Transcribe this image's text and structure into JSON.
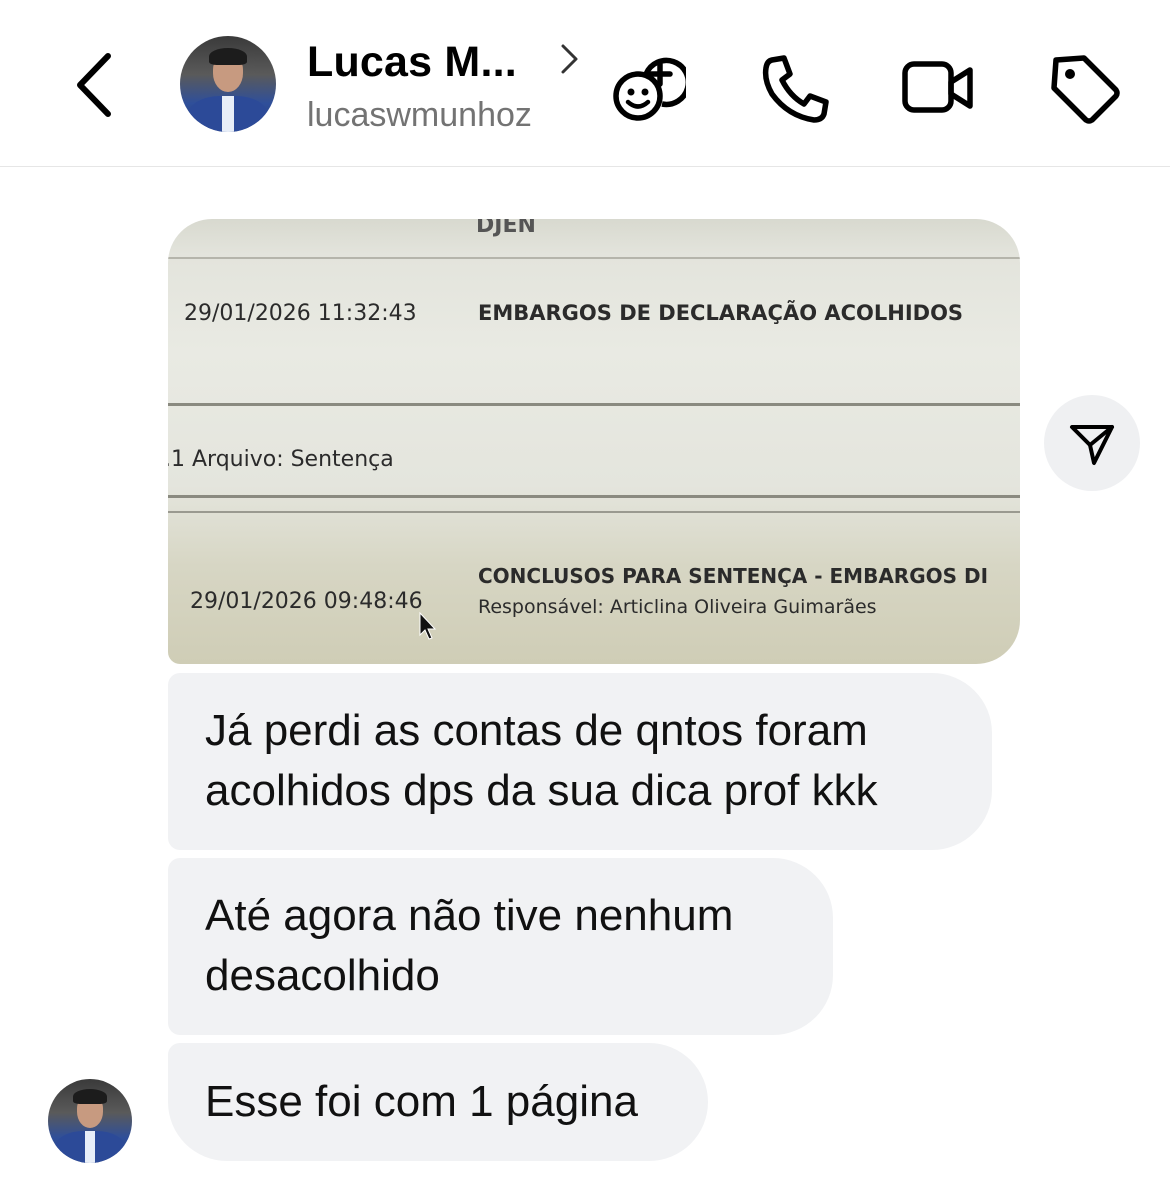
{
  "header": {
    "name": "Lucas M...",
    "username": "lucaswmunhoz",
    "icons": [
      "back-chevron-icon",
      "avatar",
      "chevron-right-icon",
      "games-icon",
      "phone-icon",
      "video-icon",
      "tag-icon"
    ]
  },
  "photo": {
    "top_partial": "DJEN",
    "row1_time": "29/01/2026 11:32:43",
    "row1_event": "EMBARGOS DE DECLARAÇÃO ACOLHIDOS",
    "row2_text": ".1 Arquivo: Sentença",
    "row3_time": "29/01/2026 09:48:46",
    "row3_event": "CONCLUSOS PARA SENTENÇA - EMBARGOS DI",
    "row3_sub": "Responsável: Articlina Oliveira Guimarães"
  },
  "messages": [
    {
      "line1": "Já perdi as contas de qntos foram",
      "line2": "acolhidos dps da sua dica prof kkk"
    },
    {
      "line1": "Até agora não tive nenhum",
      "line2": "desacolhido"
    },
    {
      "line1": "Esse foi com 1 página"
    }
  ],
  "share_icon": "send-icon"
}
